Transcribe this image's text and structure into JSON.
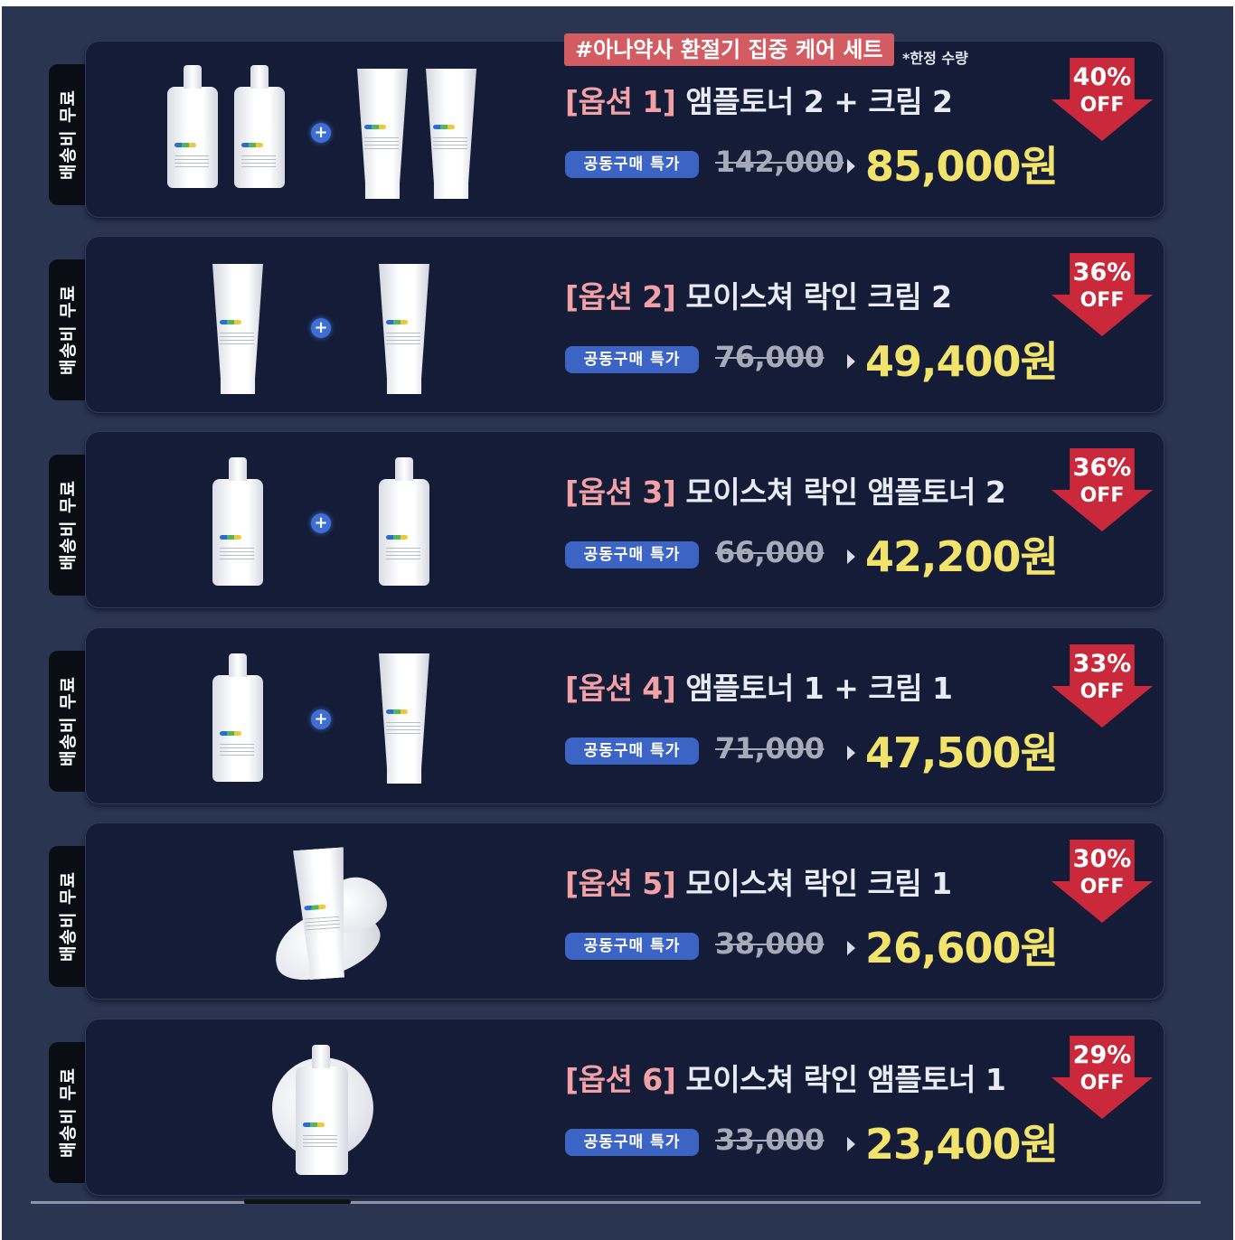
{
  "promo": {
    "tag": "#아나약사 환절기 집중 케어 세트",
    "note": "*한정 수량"
  },
  "options": [
    {
      "shipping": "배송비 무료",
      "title_option": "[옵션 1]",
      "title_text": " 앰플토너 2 + 크림 2",
      "badge": "공동구매 특가",
      "original_price": "142,000",
      "sale_price": "85,000원",
      "discount_pct": "40%",
      "off": "OFF",
      "products": [
        "bottle",
        "bottle",
        "tube",
        "tube"
      ],
      "plus_icon": "plus-icon"
    },
    {
      "shipping": "배송비 무료",
      "title_option": "[옵션 2]",
      "title_text": " 모이스쳐 락인 크림 2",
      "badge": "공동구매 특가",
      "original_price": "76,000",
      "sale_price": "49,400원",
      "discount_pct": "36%",
      "off": "OFF",
      "products": [
        "tube",
        "tube"
      ],
      "plus_icon": "plus-icon"
    },
    {
      "shipping": "배송비 무료",
      "title_option": "[옵션 3]",
      "title_text": " 모이스쳐 락인 앰플토너 2",
      "badge": "공동구매 특가",
      "original_price": "66,000",
      "sale_price": "42,200원",
      "discount_pct": "36%",
      "off": "OFF",
      "products": [
        "bottle",
        "bottle"
      ],
      "plus_icon": "plus-icon"
    },
    {
      "shipping": "배송비 무료",
      "title_option": "[옵션 4]",
      "title_text": " 앰플토너 1 + 크림 1",
      "badge": "공동구매 특가",
      "original_price": "71,000",
      "sale_price": "47,500원",
      "discount_pct": "33%",
      "off": "OFF",
      "products": [
        "bottle",
        "tube"
      ],
      "plus_icon": "plus-icon"
    },
    {
      "shipping": "배송비 무료",
      "title_option": "[옵션 5]",
      "title_text": " 모이스쳐 락인 크림 1",
      "badge": "공동구매 특가",
      "original_price": "38,000",
      "sale_price": "26,600원",
      "discount_pct": "30%",
      "off": "OFF",
      "products": [
        "tube"
      ],
      "plus_icon": ""
    },
    {
      "shipping": "배송비 무료",
      "title_option": "[옵션 6]",
      "title_text": " 모이스쳐 락인 앰플토너 1",
      "badge": "공동구매 특가",
      "original_price": "33,000",
      "sale_price": "23,400원",
      "discount_pct": "29%",
      "off": "OFF",
      "products": [
        "bottle"
      ],
      "plus_icon": ""
    }
  ],
  "colors": {
    "background": "#2a3552",
    "card": "#141c38",
    "accent_red": "#c9293a",
    "sale_yellow": "#f2e36c",
    "badge_blue": "#3b64c4",
    "option_pink": "#f2a2a6"
  }
}
